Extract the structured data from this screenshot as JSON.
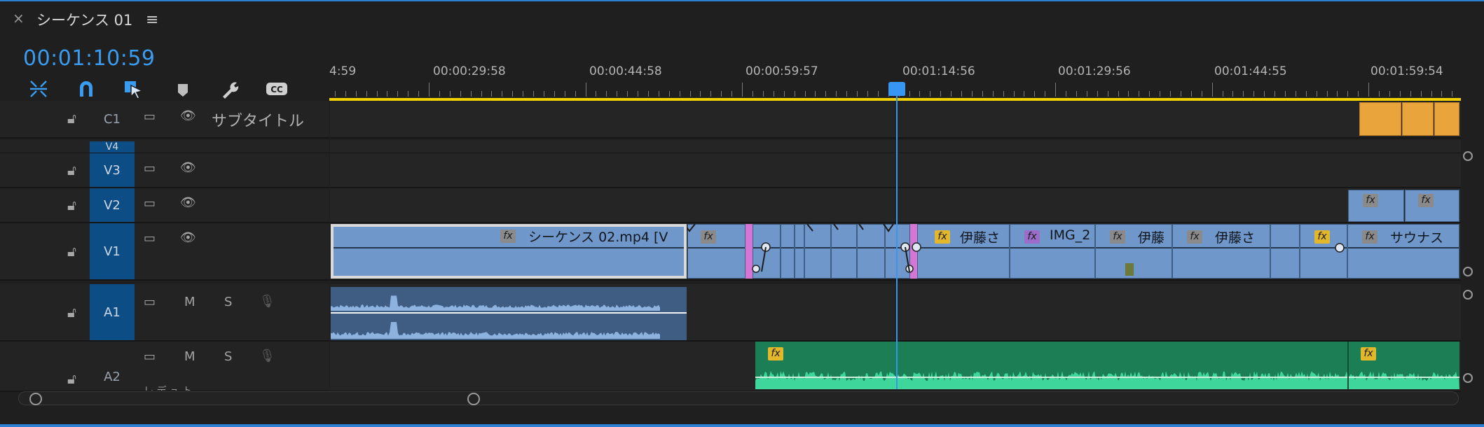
{
  "panel": {
    "close_icon": "×",
    "title": "シーケンス 01",
    "menu_icon": "≡"
  },
  "timecode": "00:01:10:59",
  "toolbar": [
    "snap-icon",
    "magnet-icon",
    "linked-selection-icon",
    "marker-icon",
    "wrench-icon",
    "captions-icon"
  ],
  "ruler": {
    "labels": [
      "4:59",
      "00:00:29:58",
      "00:00:44:58",
      "00:00:59:57",
      "00:01:14:56",
      "00:01:29:56",
      "00:01:44:55",
      "00:01:59:54"
    ]
  },
  "tracks": {
    "c1": {
      "name": "C1",
      "label": "サブタイトル"
    },
    "v4": {
      "name": "V4"
    },
    "v3": {
      "name": "V3"
    },
    "v2": {
      "name": "V2"
    },
    "v1": {
      "name": "V1"
    },
    "a1": {
      "name": "A1",
      "mute": "M",
      "solo": "S"
    },
    "a2": {
      "name": "A2",
      "mute": "M",
      "solo": "S",
      "sub": "レ デ ュ ト"
    }
  },
  "clips": {
    "fx": "fx",
    "v1_main": "シーケンス 02.mp4 [V",
    "v1_ito1": "伊藤さ",
    "v1_img": "IMG_2",
    "v1_ito2": "伊藤",
    "v1_ito3": "伊藤さ",
    "v1_sauna": "サウナス"
  },
  "colors": {
    "accent": "#3796f2",
    "video_clip": "#6f97c9",
    "audio_clip": "#3f5c83",
    "audio_green": "#1b7e55",
    "subtitle": "#e9a43c",
    "track_active": "#0c4d85"
  }
}
